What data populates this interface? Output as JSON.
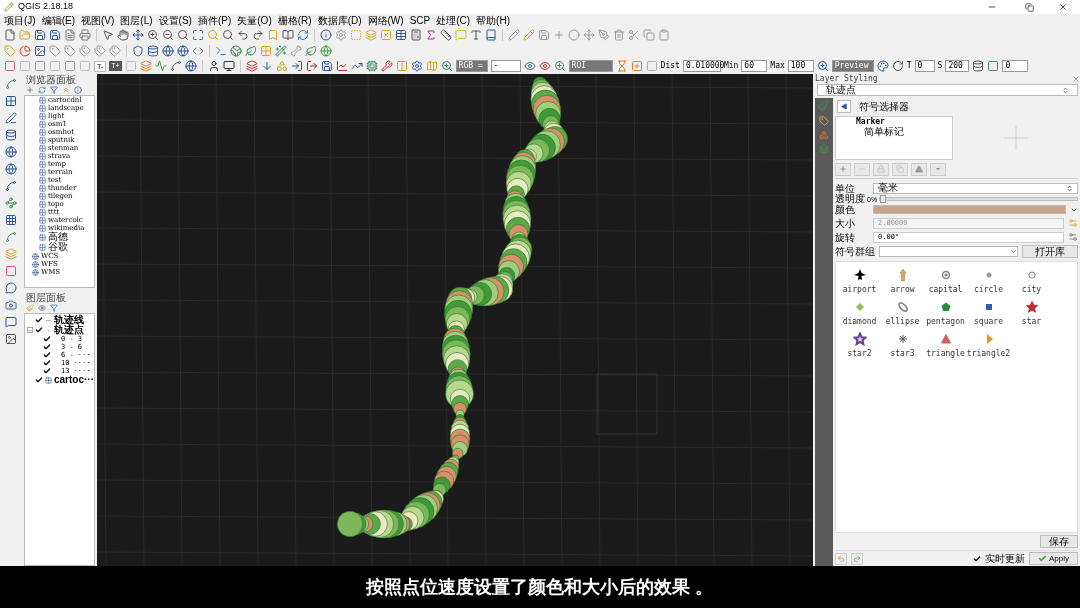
{
  "window": {
    "title": "QGIS 2.18.18"
  },
  "menu": [
    "项目(J)",
    "编辑(E)",
    "视图(V)",
    "图层(L)",
    "设置(S)",
    "插件(P)",
    "矢量(O)",
    "栅格(R)",
    "数据库(D)",
    "网络(W)",
    "SCP",
    "处理(C)",
    "帮助(H)"
  ],
  "toolbar": {
    "t_minus": "T-",
    "t_plus": "T+",
    "rgb_label": "RGB =",
    "rgb_value": "-",
    "roi": "ROI",
    "dist_label": "Dist",
    "dist": "0.010000",
    "min_label": "Min",
    "min": "60",
    "max_label": "Max",
    "max": "100",
    "preview": "Preview",
    "t_label": "T",
    "t": "0",
    "s_label": "S",
    "s": "200",
    "last": "0"
  },
  "browser": {
    "title": "浏览器面板",
    "items": [
      "cartocdnl",
      "landscape",
      "light",
      "osm1",
      "osmhot",
      "sputnik",
      "stenman",
      "strava",
      "temp",
      "terrain",
      "test",
      "thunder",
      "tilegen",
      "topo",
      "tttt",
      "watercolc",
      "wikimedia",
      "高德",
      "谷歌"
    ],
    "services": [
      "WCS",
      "WFS",
      "WMS"
    ]
  },
  "layers": {
    "title": "图层面板",
    "tree": [
      {
        "name": "轨迹线",
        "checked": true,
        "kind": "line"
      },
      {
        "name": "轨迹点",
        "checked": true,
        "kind": "point",
        "expanded": true,
        "children": [
          {
            "name": "0 - 3",
            "checked": true
          },
          {
            "name": "3 - 6",
            "checked": true
          },
          {
            "name": "6 - ···",
            "checked": true
          },
          {
            "name": "10 ····",
            "checked": true
          },
          {
            "name": "13 ····",
            "checked": true
          }
        ]
      },
      {
        "name": "cartoc···",
        "checked": true,
        "kind": "raster"
      }
    ]
  },
  "styling": {
    "title": "Layer Styling",
    "layer": "轨迹点",
    "header": "符号选择器",
    "tree": {
      "name": "Marker",
      "child": "简单标记"
    },
    "unit_label": "单位",
    "unit": "毫米",
    "opacity_label": "透明度",
    "opacity": {
      "reading": "0%",
      "level": 0
    },
    "color_label": "颜色",
    "color": "#c9a383",
    "size_label": "大小",
    "size": "2.00000",
    "size_disabled": true,
    "rotation_label": "旋转",
    "rotation": "0.00°",
    "group_label": "符号群组",
    "open_library": "打开库",
    "symbols": [
      {
        "name": "airport",
        "kind": "plane",
        "color": "#000000"
      },
      {
        "name": "arrow",
        "kind": "arrow",
        "color": "#d9a860"
      },
      {
        "name": "capital",
        "kind": "ringdot",
        "color": "#888888"
      },
      {
        "name": "circle",
        "kind": "dot",
        "color": "#999999"
      },
      {
        "name": "city",
        "kind": "ring",
        "color": "#888888"
      },
      {
        "name": "diamond",
        "kind": "diamond",
        "color": "#8fbf5a"
      },
      {
        "name": "ellipse",
        "kind": "ellipse",
        "color": "#888888"
      },
      {
        "name": "pentagon",
        "kind": "pentagon",
        "color": "#2e8b3e"
      },
      {
        "name": "square",
        "kind": "square",
        "color": "#2e5fa8"
      },
      {
        "name": "star",
        "kind": "star",
        "color": "#c8282e"
      },
      {
        "name": "star2",
        "kind": "staroutline",
        "color": "#6a3fa0"
      },
      {
        "name": "star3",
        "kind": "asterisk",
        "color": "#555555"
      },
      {
        "name": "triangle",
        "kind": "triangle",
        "color": "#d06060"
      },
      {
        "name": "triangle2",
        "kind": "halftriangle",
        "color": "#e8901e"
      }
    ],
    "save": "保存",
    "live_update": {
      "label": "实时更新",
      "checked": true
    },
    "apply": "Apply"
  },
  "caption": "按照点位速度设置了颜色和大小后的效果 。"
}
